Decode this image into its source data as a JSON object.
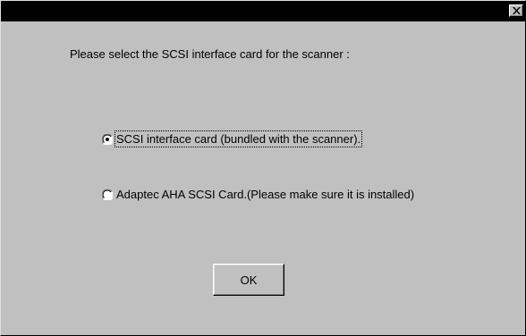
{
  "dialog": {
    "close_icon": "close-x-icon",
    "prompt": "Please select the SCSI interface card for the scanner :",
    "options": [
      {
        "label": "SCSI interface card (bundled with the scanner).",
        "selected": true
      },
      {
        "label": "Adaptec AHA SCSI Card.(Please make sure it is installed)",
        "selected": false
      }
    ],
    "ok_label": "OK"
  },
  "colors": {
    "titlebar": "#000000",
    "face": "#c0c0c0"
  }
}
